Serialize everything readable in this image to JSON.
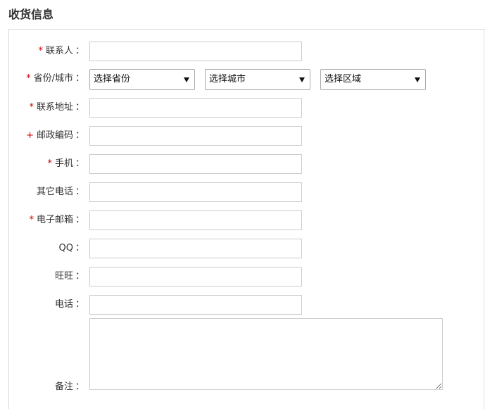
{
  "section": {
    "title": "收货信息"
  },
  "form": {
    "contact": {
      "label": "联系人",
      "required_mark": "*",
      "value": ""
    },
    "region": {
      "label": "省份/城市",
      "required_mark": "*",
      "province": "选择省份",
      "city": "选择城市",
      "district": "选择区域"
    },
    "address": {
      "label": "联系地址",
      "required_mark": "*",
      "value": ""
    },
    "postcode": {
      "label": "邮政编码",
      "required_mark": "+",
      "value": ""
    },
    "mobile": {
      "label": "手机",
      "required_mark": "*",
      "value": ""
    },
    "other_phone": {
      "label": "其它电话",
      "value": ""
    },
    "email": {
      "label": "电子邮箱",
      "required_mark": "*",
      "value": ""
    },
    "qq": {
      "label": "QQ",
      "value": ""
    },
    "wangwang": {
      "label": "旺旺",
      "value": ""
    },
    "phone": {
      "label": "电话",
      "value": ""
    },
    "notes": {
      "label": "备注",
      "value": ""
    },
    "colon": "："
  },
  "colors": {
    "required": "#cc0000",
    "border": "#cccccc",
    "text": "#333333"
  }
}
